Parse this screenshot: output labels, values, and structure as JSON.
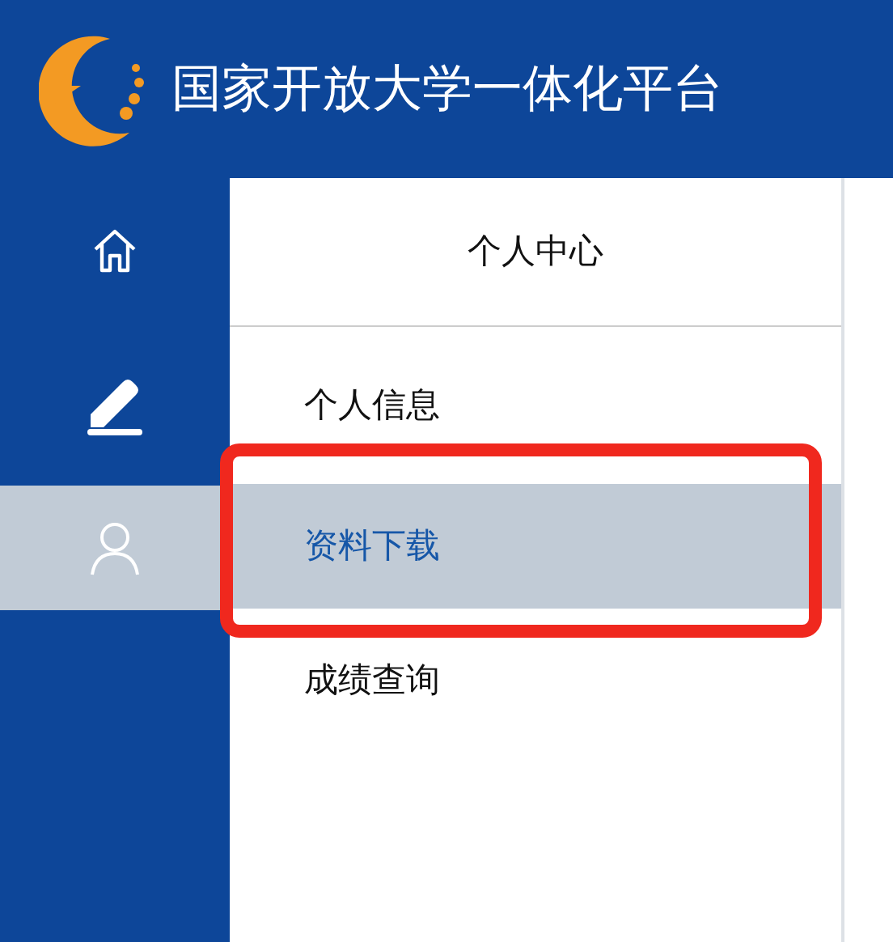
{
  "header": {
    "title": "国家开放大学一体化平台"
  },
  "rail": [
    {
      "kind": "home",
      "selected": false
    },
    {
      "kind": "edit",
      "selected": false
    },
    {
      "kind": "user",
      "selected": true
    }
  ],
  "panel": {
    "title": "个人中心",
    "items": [
      {
        "label": "个人信息",
        "selected": false,
        "highlighted": false
      },
      {
        "label": "资料下载",
        "selected": true,
        "highlighted": true
      },
      {
        "label": "成绩查询",
        "selected": false,
        "highlighted": false
      }
    ]
  }
}
